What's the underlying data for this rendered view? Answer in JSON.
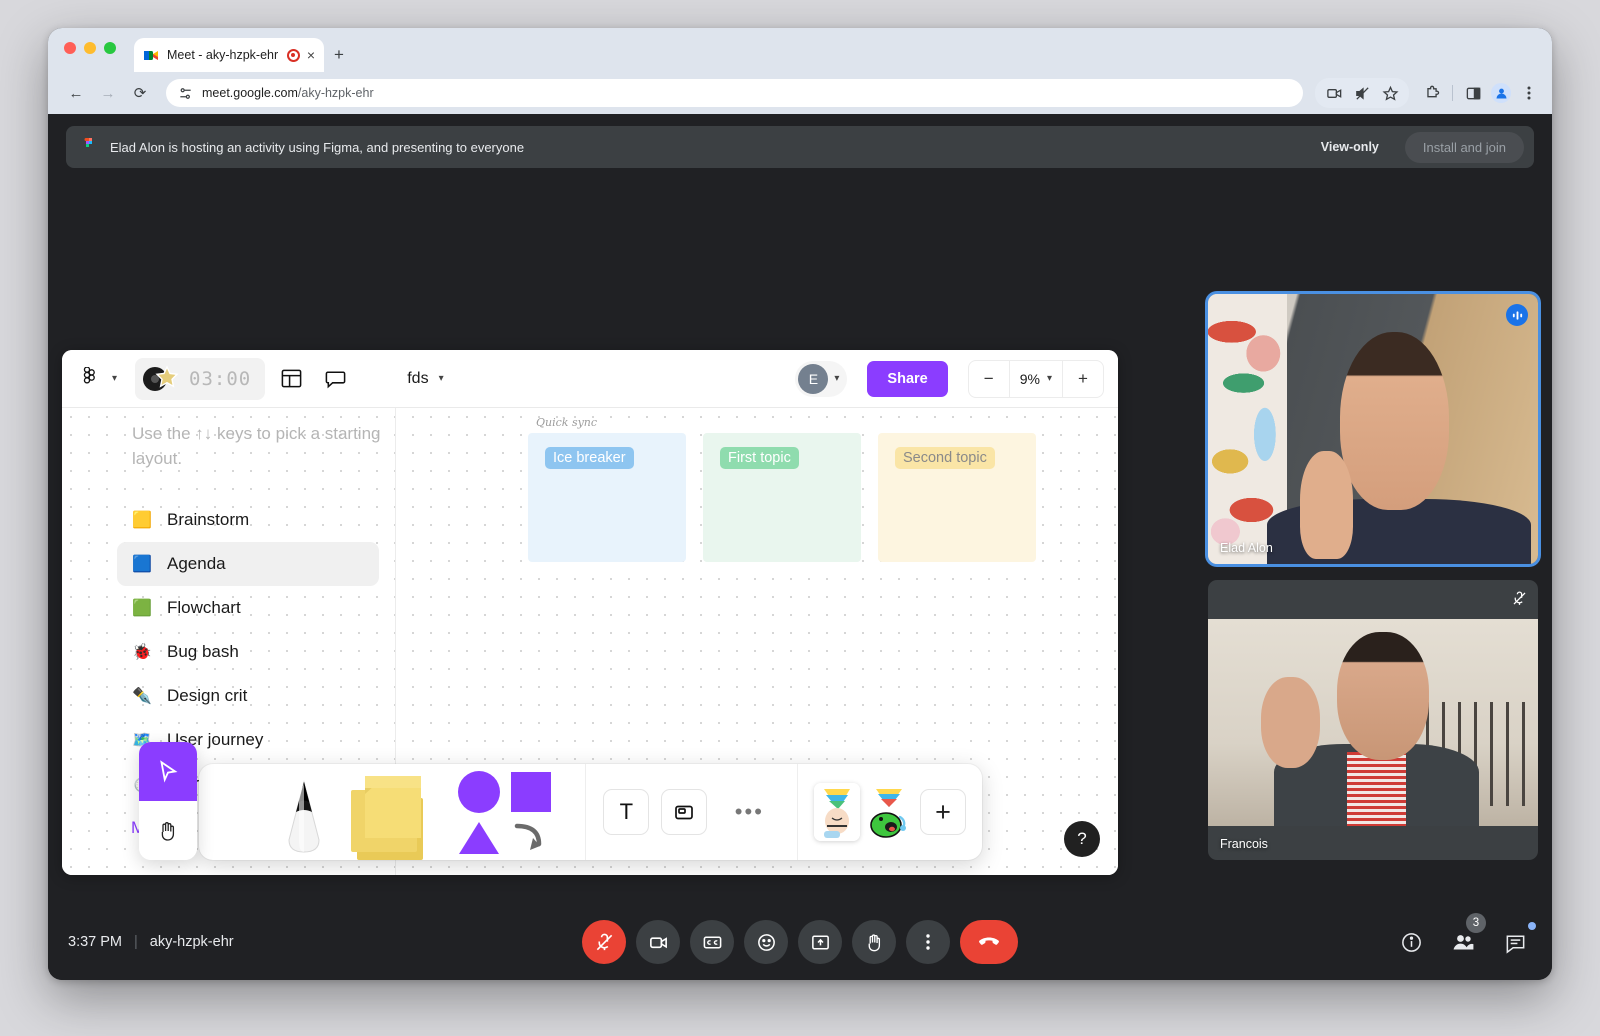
{
  "browser": {
    "tab": {
      "title": "Meet - aky-hzpk-ehr",
      "favicon_name": "google-meet-favicon",
      "recording_indicator": "recording-icon",
      "close": "×"
    },
    "new_tab_label": "+",
    "nav": {
      "back": "←",
      "forward": "→",
      "reload": "⟳"
    },
    "url": {
      "domain": "meet.google.com",
      "path": "/aky-hzpk-ehr"
    },
    "toolbar_icons": [
      "camera-icon",
      "mute-site-icon",
      "bookmark-star-icon",
      "extensions-icon",
      "side-panel-icon",
      "profile-avatar-icon",
      "chrome-menu-icon"
    ]
  },
  "banner": {
    "app_icon": "figma-icon",
    "text": "Elad Alon is hosting an activity using Figma, and presenting to everyone",
    "view_only_label": "View-only",
    "install_button": "Install and join"
  },
  "figma": {
    "logo": "figma-logo-icon",
    "timer": {
      "value": "03:00",
      "icon": "music-star-icon"
    },
    "icons": [
      "layout-panel-icon",
      "comment-icon"
    ],
    "file_name": "fds",
    "avatar_initial": "E",
    "share_label": "Share",
    "zoom": {
      "minus": "−",
      "value": "9%",
      "plus": "+"
    },
    "left_panel": {
      "hint": "Use the ↑↓ keys to pick a starting layout.",
      "items": [
        {
          "label": "Brainstorm",
          "emoji": "🟨",
          "selected": false
        },
        {
          "label": "Agenda",
          "emoji": "🟦",
          "selected": true
        },
        {
          "label": "Flowchart",
          "emoji": "🟩",
          "selected": false
        },
        {
          "label": "Bug bash",
          "emoji": "🐞",
          "selected": false
        },
        {
          "label": "Design crit",
          "emoji": "✒️",
          "selected": false
        },
        {
          "label": "User journey",
          "emoji": "🗺️",
          "selected": false
        },
        {
          "label": "Retro",
          "emoji": "⏱️",
          "selected": false
        }
      ],
      "more_label": "M"
    },
    "board": {
      "title": "Quick sync",
      "columns": [
        {
          "label": "Ice breaker",
          "color": "#e8f3fc",
          "tag_color": "#8ec5f0"
        },
        {
          "label": "First topic",
          "color": "#e9f6ee",
          "tag_color": "#8fdcae"
        },
        {
          "label": "Second topic",
          "color": "#fdf5e0",
          "tag_color": "#fae5a6"
        }
      ]
    },
    "toolbar": {
      "cursor_icon": "cursor-arrow-icon",
      "hand_icon": "hand-pan-icon",
      "pen_icon": "marker-pen-icon",
      "sticky_icon": "sticky-note-icon",
      "shapes_icon": "shapes-icon",
      "text_icon": "T",
      "frame_icon": "frame-icon",
      "more_icon": "•••",
      "sticker1_icon": "party-face-sticker",
      "sticker2_icon": "party-monster-sticker",
      "add_icon": "+"
    },
    "help_label": "?"
  },
  "tiles": [
    {
      "name": "Elad Alon",
      "badge": "audio-active-icon",
      "speaking": true
    },
    {
      "name": "Francois",
      "badge": "mic-off-icon",
      "speaking": false
    }
  ],
  "controls": {
    "time": "3:37 PM",
    "separator": "|",
    "meeting_code": "aky-hzpk-ehr",
    "buttons": [
      {
        "name": "mic-off-button",
        "icon": "mic-off-icon",
        "state": "muted"
      },
      {
        "name": "camera-button",
        "icon": "camera-icon",
        "state": "on"
      },
      {
        "name": "captions-button",
        "icon": "captions-icon",
        "state": "off"
      },
      {
        "name": "emoji-button",
        "icon": "emoji-icon",
        "state": "off"
      },
      {
        "name": "present-button",
        "icon": "present-screen-icon",
        "state": "off"
      },
      {
        "name": "raise-hand-button",
        "icon": "raise-hand-icon",
        "state": "off"
      },
      {
        "name": "more-options-button",
        "icon": "more-vertical-icon",
        "state": "off"
      },
      {
        "name": "end-call-button",
        "icon": "end-call-icon",
        "state": "danger"
      }
    ],
    "right": {
      "info": "info-icon",
      "people": "people-icon",
      "people_count": "3",
      "chat": "chat-icon",
      "chat_unread": true
    }
  },
  "colors": {
    "figma_purple": "#8b3dff",
    "meet_red": "#ea4335",
    "meet_blue": "#1a73e8",
    "speaking_border": "#4a90e2",
    "dark_bg": "#202124",
    "banner_bg": "#3c4043"
  }
}
